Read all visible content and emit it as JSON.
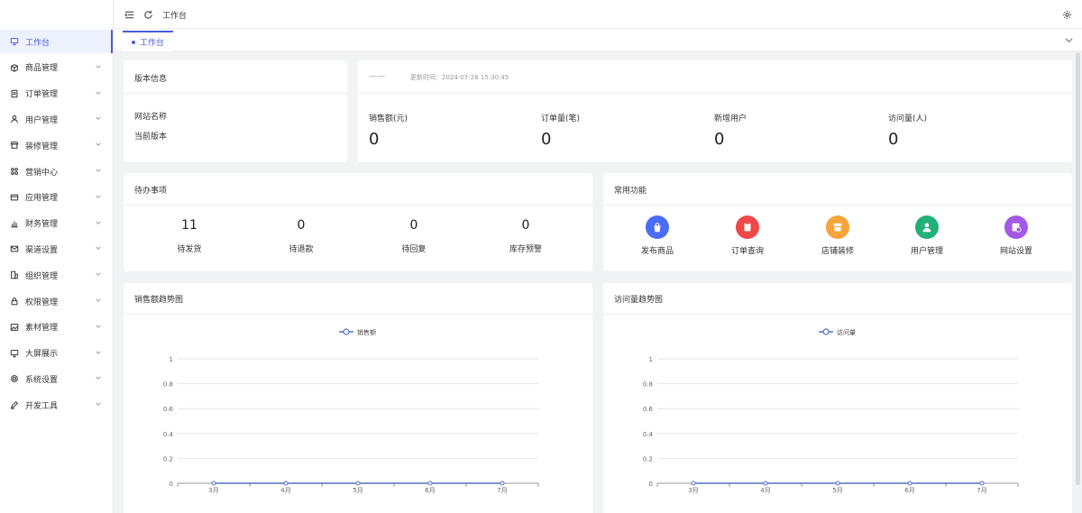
{
  "sidebar": {
    "items": [
      {
        "label": "工作台",
        "icon": "monitor-icon",
        "active": true,
        "expandable": false
      },
      {
        "label": "商品管理",
        "icon": "box-icon",
        "active": false,
        "expandable": true
      },
      {
        "label": "订单管理",
        "icon": "document-icon",
        "active": false,
        "expandable": true
      },
      {
        "label": "用户管理",
        "icon": "user-icon",
        "active": false,
        "expandable": true
      },
      {
        "label": "装修管理",
        "icon": "store-icon",
        "active": false,
        "expandable": true
      },
      {
        "label": "营销中心",
        "icon": "grid-icon",
        "active": false,
        "expandable": true
      },
      {
        "label": "应用管理",
        "icon": "app-icon",
        "active": false,
        "expandable": true
      },
      {
        "label": "财务管理",
        "icon": "bar-chart-icon",
        "active": false,
        "expandable": true
      },
      {
        "label": "渠道设置",
        "icon": "mail-icon",
        "active": false,
        "expandable": true
      },
      {
        "label": "组织管理",
        "icon": "building-icon",
        "active": false,
        "expandable": true
      },
      {
        "label": "权限管理",
        "icon": "lock-icon",
        "active": false,
        "expandable": true
      },
      {
        "label": "素材管理",
        "icon": "image-icon",
        "active": false,
        "expandable": true
      },
      {
        "label": "大屏展示",
        "icon": "screen-icon",
        "active": false,
        "expandable": true
      },
      {
        "label": "系统设置",
        "icon": "gear-icon",
        "active": false,
        "expandable": true
      },
      {
        "label": "开发工具",
        "icon": "pen-icon",
        "active": false,
        "expandable": true
      }
    ]
  },
  "header": {
    "breadcrumb": "工作台",
    "icons": [
      "menu-fold-icon",
      "refresh-icon",
      "settings-icon"
    ]
  },
  "tabs": [
    {
      "label": "工作台",
      "active": true
    }
  ],
  "version_card": {
    "title": "版本信息",
    "rows": [
      {
        "label": "网站名称"
      },
      {
        "label": "当前版本"
      }
    ]
  },
  "stats_card": {
    "title": "——",
    "update_time": "更新时间：2024-07-26 15:30:45",
    "items": [
      {
        "label": "销售额(元)",
        "value": "0"
      },
      {
        "label": "订单量(笔)",
        "value": "0"
      },
      {
        "label": "新增用户",
        "value": "0"
      },
      {
        "label": "访问量(人)",
        "value": "0"
      }
    ]
  },
  "todo_card": {
    "title": "待办事项",
    "items": [
      {
        "label": "待发货",
        "value": "11"
      },
      {
        "label": "待退款",
        "value": "0"
      },
      {
        "label": "待回复",
        "value": "0"
      },
      {
        "label": "库存预警",
        "value": "0"
      }
    ]
  },
  "functions_card": {
    "title": "常用功能",
    "items": [
      {
        "label": "发布商品",
        "icon": "bag-icon",
        "color": "#4a6cf7"
      },
      {
        "label": "订单查询",
        "icon": "clipboard-icon",
        "color": "#f04848"
      },
      {
        "label": "店铺装修",
        "icon": "shop-icon",
        "color": "#f7a43a"
      },
      {
        "label": "用户管理",
        "icon": "user-icon",
        "color": "#21b07a"
      },
      {
        "label": "网站设置",
        "icon": "site-settings-icon",
        "color": "#a259e6"
      }
    ]
  },
  "chart_data": [
    {
      "type": "line",
      "title": "销售额趋势图",
      "x": [
        "3月",
        "4月",
        "5月",
        "6月",
        "7月"
      ],
      "series": [
        {
          "name": "销售额",
          "values": [
            0,
            0,
            0,
            0,
            0
          ]
        }
      ],
      "yticks": [
        "0",
        "0.2",
        "0.4",
        "0.6",
        "0.8",
        "1"
      ],
      "ylim": [
        0,
        1
      ],
      "color": "#5470c6",
      "legend": "top-center",
      "grid": true
    },
    {
      "type": "line",
      "title": "访问量趋势图",
      "x": [
        "3月",
        "4月",
        "5月",
        "6月",
        "7月"
      ],
      "series": [
        {
          "name": "访问量",
          "values": [
            0,
            0,
            0,
            0,
            0
          ]
        }
      ],
      "yticks": [
        "0",
        "0.2",
        "0.4",
        "0.6",
        "0.8",
        "1"
      ],
      "ylim": [
        0,
        1
      ],
      "color": "#5470c6",
      "legend": "top-center",
      "grid": true
    }
  ]
}
